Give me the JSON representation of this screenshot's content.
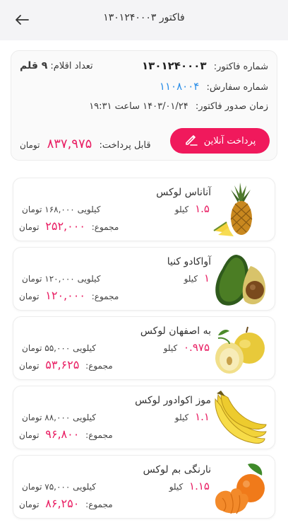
{
  "header": {
    "title": "فاکتور ۱۳۰۱۲۴۰۰۰۳"
  },
  "summary": {
    "invoice_label": "شماره فاکتور:",
    "invoice_number": "۱۳۰۱۲۴۰۰۰۳",
    "items_count_label": "تعداد اقلام:",
    "items_count": "۹ قلم",
    "order_label": "شماره سفارش:",
    "order_number": "۱۱۰۸۰۰۴",
    "issue_label": "زمان صدور فاکتور:",
    "issue_time": "۱۴۰۳/۰۱/۲۴ ساعت ۱۹:۳۱",
    "pay_button": "پرداخت آنلاین",
    "payable_label": "قابل پرداخت:",
    "payable_amount": "۸۳۷,۹۷۵",
    "currency": "تومان"
  },
  "items": [
    {
      "name": "آناناس لوکس",
      "qty": "۱.۵",
      "unit": "کیلو",
      "unit_price_label": "کیلویی ۱۶۸,۰۰۰",
      "currency": "تومان",
      "total_label": "مجموع:",
      "total": "۲۵۲,۰۰۰"
    },
    {
      "name": "آواکادو کنیا",
      "qty": "۱",
      "unit": "کیلو",
      "unit_price_label": "کیلویی ۱۲۰,۰۰۰",
      "currency": "تومان",
      "total_label": "مجموع:",
      "total": "۱۲۰,۰۰۰"
    },
    {
      "name": "به اصفهان لوکس",
      "qty": "۰.۹۷۵",
      "unit": "کیلو",
      "unit_price_label": "کیلویی ۵۵,۰۰۰",
      "currency": "تومان",
      "total_label": "مجموع:",
      "total": "۵۳,۶۲۵"
    },
    {
      "name": "موز اکوادور لوکس",
      "qty": "۱.۱",
      "unit": "کیلو",
      "unit_price_label": "کیلویی ۸۸,۰۰۰",
      "currency": "تومان",
      "total_label": "مجموع:",
      "total": "۹۶,۸۰۰"
    },
    {
      "name": "نارنگی بم لوکس",
      "qty": "۱.۱۵",
      "unit": "کیلو",
      "unit_price_label": "کیلویی ۷۵,۰۰۰",
      "currency": "تومان",
      "total_label": "مجموع:",
      "total": "۸۶,۲۵۰"
    }
  ],
  "colors": {
    "accent": "#f0195c",
    "price": "#e91e63",
    "link": "#2b8ee8"
  }
}
